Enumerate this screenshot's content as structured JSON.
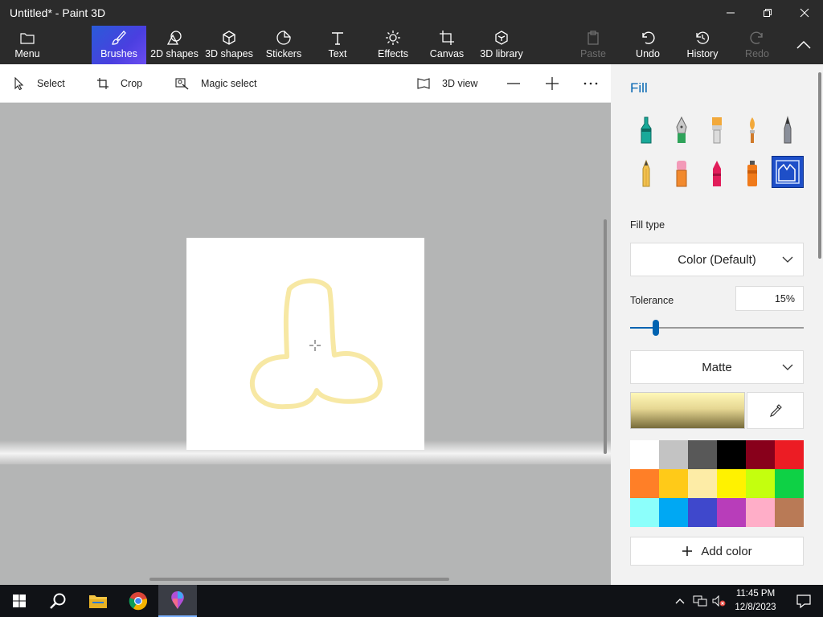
{
  "window": {
    "title": "Untitled* - Paint 3D"
  },
  "ribbon": {
    "menu": "Menu",
    "brushes": "Brushes",
    "shapes2d": "2D shapes",
    "shapes3d": "3D shapes",
    "stickers": "Stickers",
    "text": "Text",
    "effects": "Effects",
    "canvas": "Canvas",
    "library3d": "3D library",
    "paste": "Paste",
    "undo": "Undo",
    "history": "History",
    "redo": "Redo"
  },
  "toolbar": {
    "select": "Select",
    "crop": "Crop",
    "magic_select": "Magic select",
    "view3d": "3D view"
  },
  "panel": {
    "title": "Fill",
    "fill_type_label": "Fill type",
    "fill_type_value": "Color (Default)",
    "tolerance_label": "Tolerance",
    "tolerance_value": "15%",
    "tolerance_fraction": 0.15,
    "finish_value": "Matte",
    "add_color": "Add color",
    "selected_color": "#f5e6a0",
    "palette": [
      "#ffffff",
      "#c3c3c3",
      "#585858",
      "#000000",
      "#88001b",
      "#ec1c24",
      "#ff7f27",
      "#ffca18",
      "#fdeca6",
      "#fff200",
      "#c4ff0e",
      "#0ed145",
      "#8cfffb",
      "#00a8f3",
      "#3f48cc",
      "#b83dba",
      "#ffaec8",
      "#b97a56"
    ]
  },
  "taskbar": {
    "time": "11:45 PM",
    "date": "12/8/2023"
  }
}
